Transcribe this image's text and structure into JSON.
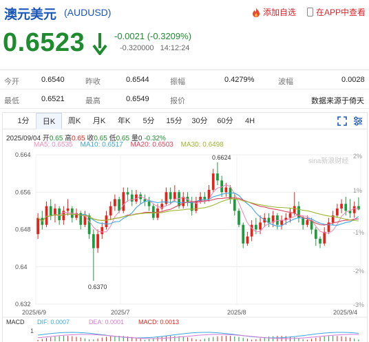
{
  "header": {
    "title": "澳元美元",
    "code": "(AUDUSD)",
    "watch_label": "添加自选",
    "app_label": "在APP中查看"
  },
  "quote": {
    "price": "0.6523",
    "change": "-0.0021",
    "change_pct": "(-0.3209%)",
    "sub_change": "-0.320000",
    "time": "14:12:24"
  },
  "stats": {
    "row1": [
      {
        "label": "今开",
        "value": "0.6540"
      },
      {
        "label": "昨收",
        "value": "0.6544"
      },
      {
        "label": "振幅",
        "value": "0.4279%"
      },
      {
        "label": "波幅",
        "value": "0.0028"
      }
    ],
    "row2": [
      {
        "label": "最低",
        "value": "0.6521"
      },
      {
        "label": "最高",
        "value": "0.6549"
      },
      {
        "label": "报价",
        "value": ""
      },
      {
        "label": "",
        "value": "数据来源于倚天"
      }
    ]
  },
  "tabs": [
    "1分",
    "日K",
    "周K",
    "月K",
    "年K",
    "5分",
    "15分",
    "30分",
    "60分",
    "4H"
  ],
  "active_tab": "日K",
  "icons": [
    "expand-icon",
    "settings-icon"
  ],
  "chart_info": {
    "date": "2025/09/04",
    "open_label": "开",
    "open": "0.65",
    "high_label": "高",
    "high": "0.65",
    "close_label": "收",
    "close": "0.65",
    "low_label": "低",
    "low": "0.65",
    "vol_label": "量",
    "vol": "0",
    "pct": "-0.32%"
  },
  "ma": [
    {
      "label": "MA5: 0.6535",
      "color": "#f08cbc"
    },
    {
      "label": "MA10: 0.6517",
      "color": "#3aa6e0"
    },
    {
      "label": "MA20: 0.6503",
      "color": "#e0405a"
    },
    {
      "label": "MA30: 0.6498",
      "color": "#9cb830"
    }
  ],
  "macd": {
    "label": "MACD",
    "dif": "DIF: 0.0007",
    "dea": "DEA: 0.0001",
    "macd": "MACD: 0.0013",
    "ytick": "1"
  },
  "watermark": "sina新浪财经",
  "chart_data": {
    "type": "candlestick",
    "y_ticks": [
      "0.664",
      "0.656",
      "0.648",
      "0.64",
      "0.632"
    ],
    "y_ticks_right": [
      "2%",
      "1%",
      "-1%",
      "-2%",
      "-3%"
    ],
    "x_ticks": [
      "2025/6/9",
      "2025/7",
      "2025/8",
      "2025/9/4"
    ],
    "ylim": [
      0.632,
      0.664
    ],
    "annotations": {
      "high": "0.6624",
      "low": "0.6370"
    },
    "candles": [
      [
        0.647,
        0.6505,
        0.6515,
        0.646
      ],
      [
        0.6505,
        0.649,
        0.652,
        0.648
      ],
      [
        0.649,
        0.653,
        0.654,
        0.6485
      ],
      [
        0.653,
        0.651,
        0.6545,
        0.65
      ],
      [
        0.651,
        0.6525,
        0.6535,
        0.6495
      ],
      [
        0.6525,
        0.65,
        0.653,
        0.649
      ],
      [
        0.65,
        0.652,
        0.653,
        0.649
      ],
      [
        0.652,
        0.6525,
        0.6545,
        0.651
      ],
      [
        0.6525,
        0.6505,
        0.653,
        0.6495
      ],
      [
        0.6505,
        0.6515,
        0.6525,
        0.65
      ],
      [
        0.6515,
        0.649,
        0.652,
        0.648
      ],
      [
        0.649,
        0.651,
        0.652,
        0.6485
      ],
      [
        0.651,
        0.647,
        0.6515,
        0.646
      ],
      [
        0.647,
        0.644,
        0.648,
        0.637
      ],
      [
        0.644,
        0.647,
        0.648,
        0.643
      ],
      [
        0.647,
        0.6485,
        0.6495,
        0.646
      ],
      [
        0.6485,
        0.651,
        0.652,
        0.648
      ],
      [
        0.651,
        0.653,
        0.654,
        0.65
      ],
      [
        0.653,
        0.6545,
        0.6555,
        0.652
      ],
      [
        0.6545,
        0.652,
        0.655,
        0.6515
      ],
      [
        0.652,
        0.656,
        0.657,
        0.6515
      ],
      [
        0.656,
        0.6555,
        0.657,
        0.654
      ],
      [
        0.6555,
        0.654,
        0.6565,
        0.653
      ],
      [
        0.654,
        0.6555,
        0.6565,
        0.6535
      ],
      [
        0.6555,
        0.6545,
        0.656,
        0.6535
      ],
      [
        0.6545,
        0.654,
        0.6555,
        0.653
      ],
      [
        0.654,
        0.653,
        0.655,
        0.652
      ],
      [
        0.653,
        0.6505,
        0.6535,
        0.65
      ],
      [
        0.6505,
        0.6525,
        0.6535,
        0.65
      ],
      [
        0.6525,
        0.6535,
        0.6545,
        0.652
      ],
      [
        0.6535,
        0.656,
        0.657,
        0.653
      ],
      [
        0.656,
        0.6545,
        0.657,
        0.6535
      ],
      [
        0.6545,
        0.656,
        0.6575,
        0.654
      ],
      [
        0.656,
        0.653,
        0.6565,
        0.6525
      ],
      [
        0.653,
        0.655,
        0.656,
        0.6525
      ],
      [
        0.655,
        0.654,
        0.656,
        0.653
      ],
      [
        0.654,
        0.652,
        0.655,
        0.651
      ],
      [
        0.652,
        0.654,
        0.655,
        0.6515
      ],
      [
        0.654,
        0.655,
        0.656,
        0.6535
      ],
      [
        0.655,
        0.6545,
        0.656,
        0.6535
      ],
      [
        0.6545,
        0.6565,
        0.6575,
        0.654
      ],
      [
        0.6565,
        0.66,
        0.661,
        0.656
      ],
      [
        0.66,
        0.6585,
        0.6624,
        0.6575
      ],
      [
        0.6585,
        0.656,
        0.6595,
        0.655
      ],
      [
        0.656,
        0.657,
        0.658,
        0.655
      ],
      [
        0.657,
        0.6545,
        0.6575,
        0.6535
      ],
      [
        0.6545,
        0.652,
        0.6555,
        0.651
      ],
      [
        0.652,
        0.649,
        0.6525,
        0.6485
      ],
      [
        0.649,
        0.645,
        0.6495,
        0.644
      ],
      [
        0.645,
        0.6465,
        0.6475,
        0.6445
      ],
      [
        0.6465,
        0.649,
        0.65,
        0.6455
      ],
      [
        0.649,
        0.648,
        0.6505,
        0.647
      ],
      [
        0.648,
        0.6495,
        0.651,
        0.647
      ],
      [
        0.6495,
        0.6505,
        0.6515,
        0.6485
      ],
      [
        0.6505,
        0.6495,
        0.6515,
        0.6485
      ],
      [
        0.6495,
        0.651,
        0.652,
        0.6485
      ],
      [
        0.651,
        0.649,
        0.6515,
        0.648
      ],
      [
        0.649,
        0.65,
        0.651,
        0.648
      ],
      [
        0.65,
        0.6505,
        0.6515,
        0.649
      ],
      [
        0.6505,
        0.6515,
        0.6525,
        0.6495
      ],
      [
        0.6515,
        0.653,
        0.656,
        0.651
      ],
      [
        0.653,
        0.6505,
        0.654,
        0.6495
      ],
      [
        0.6505,
        0.649,
        0.651,
        0.648
      ],
      [
        0.649,
        0.65,
        0.651,
        0.6485
      ],
      [
        0.65,
        0.648,
        0.6505,
        0.647
      ],
      [
        0.648,
        0.646,
        0.6485,
        0.6445
      ],
      [
        0.646,
        0.645,
        0.6465,
        0.644
      ],
      [
        0.645,
        0.6475,
        0.6485,
        0.6445
      ],
      [
        0.6475,
        0.6495,
        0.6505,
        0.647
      ],
      [
        0.6495,
        0.651,
        0.652,
        0.649
      ],
      [
        0.651,
        0.6525,
        0.6535,
        0.6505
      ],
      [
        0.6525,
        0.6535,
        0.6545,
        0.6515
      ],
      [
        0.6535,
        0.652,
        0.655,
        0.651
      ],
      [
        0.652,
        0.6515,
        0.6545,
        0.6505
      ],
      [
        0.6515,
        0.653,
        0.654,
        0.6505
      ],
      [
        0.653,
        0.6523,
        0.6549,
        0.6521
      ]
    ]
  }
}
